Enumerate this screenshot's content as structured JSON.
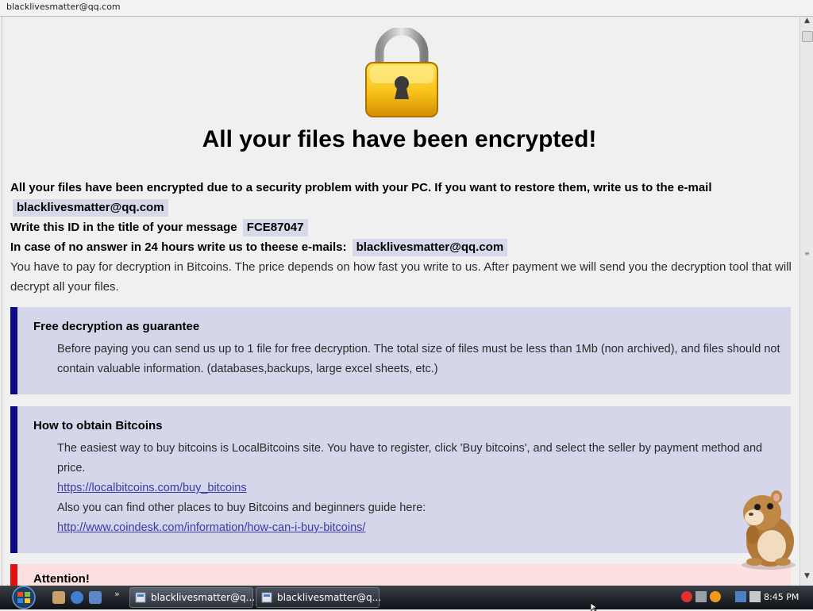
{
  "window": {
    "title": "blacklivesmatter@qq.com"
  },
  "note": {
    "heading": "All your files have been encrypted!",
    "intro": "All your files have been encrypted due to a security problem with your PC. If you want to restore them, write us to the e-mail",
    "email": "blacklivesmatter@qq.com",
    "id_label": "Write this ID in the title of your message",
    "id_value": "FCE87047",
    "alt_label": "In case of no answer in 24 hours write us to theese e-mails:",
    "alt_email": "blacklivesmatter@qq.com",
    "pay_text": "You have to pay for decryption in Bitcoins. The price depends on how fast you write to us. After payment we will send you the decryption tool that will decrypt all your files."
  },
  "free_box": {
    "title": "Free decryption as guarantee",
    "body": "Before paying you can send us up to 1 file for free decryption. The total size of files must be less than 1Mb (non archived), and files should not contain valuable information. (databases,backups, large excel sheets, etc.)"
  },
  "bitcoin_box": {
    "title": "How to obtain Bitcoins",
    "body1": "The easiest way to buy bitcoins is LocalBitcoins site. You have to register, click 'Buy bitcoins', and select the seller by payment method and price.",
    "link1": "https://localbitcoins.com/buy_bitcoins",
    "body2": "Also you can find other places to buy Bitcoins and beginners guide here:",
    "link2": "http://www.coindesk.com/information/how-can-i-buy-bitcoins/"
  },
  "attention": {
    "title": "Attention!"
  },
  "taskbar": {
    "tasks": [
      {
        "label": "blacklivesmatter@q..."
      },
      {
        "label": "blacklivesmatter@q..."
      }
    ],
    "clock": "8:45 PM"
  },
  "icons": {
    "lock": "padlock-icon",
    "mascot": "hamster-icon",
    "start": "windows-start-icon"
  },
  "colors": {
    "box_bg": "#d5d6ea",
    "box_accent": "#0c0c8a",
    "attention_accent": "#e01010",
    "attention_bg": "#fde0e0"
  }
}
